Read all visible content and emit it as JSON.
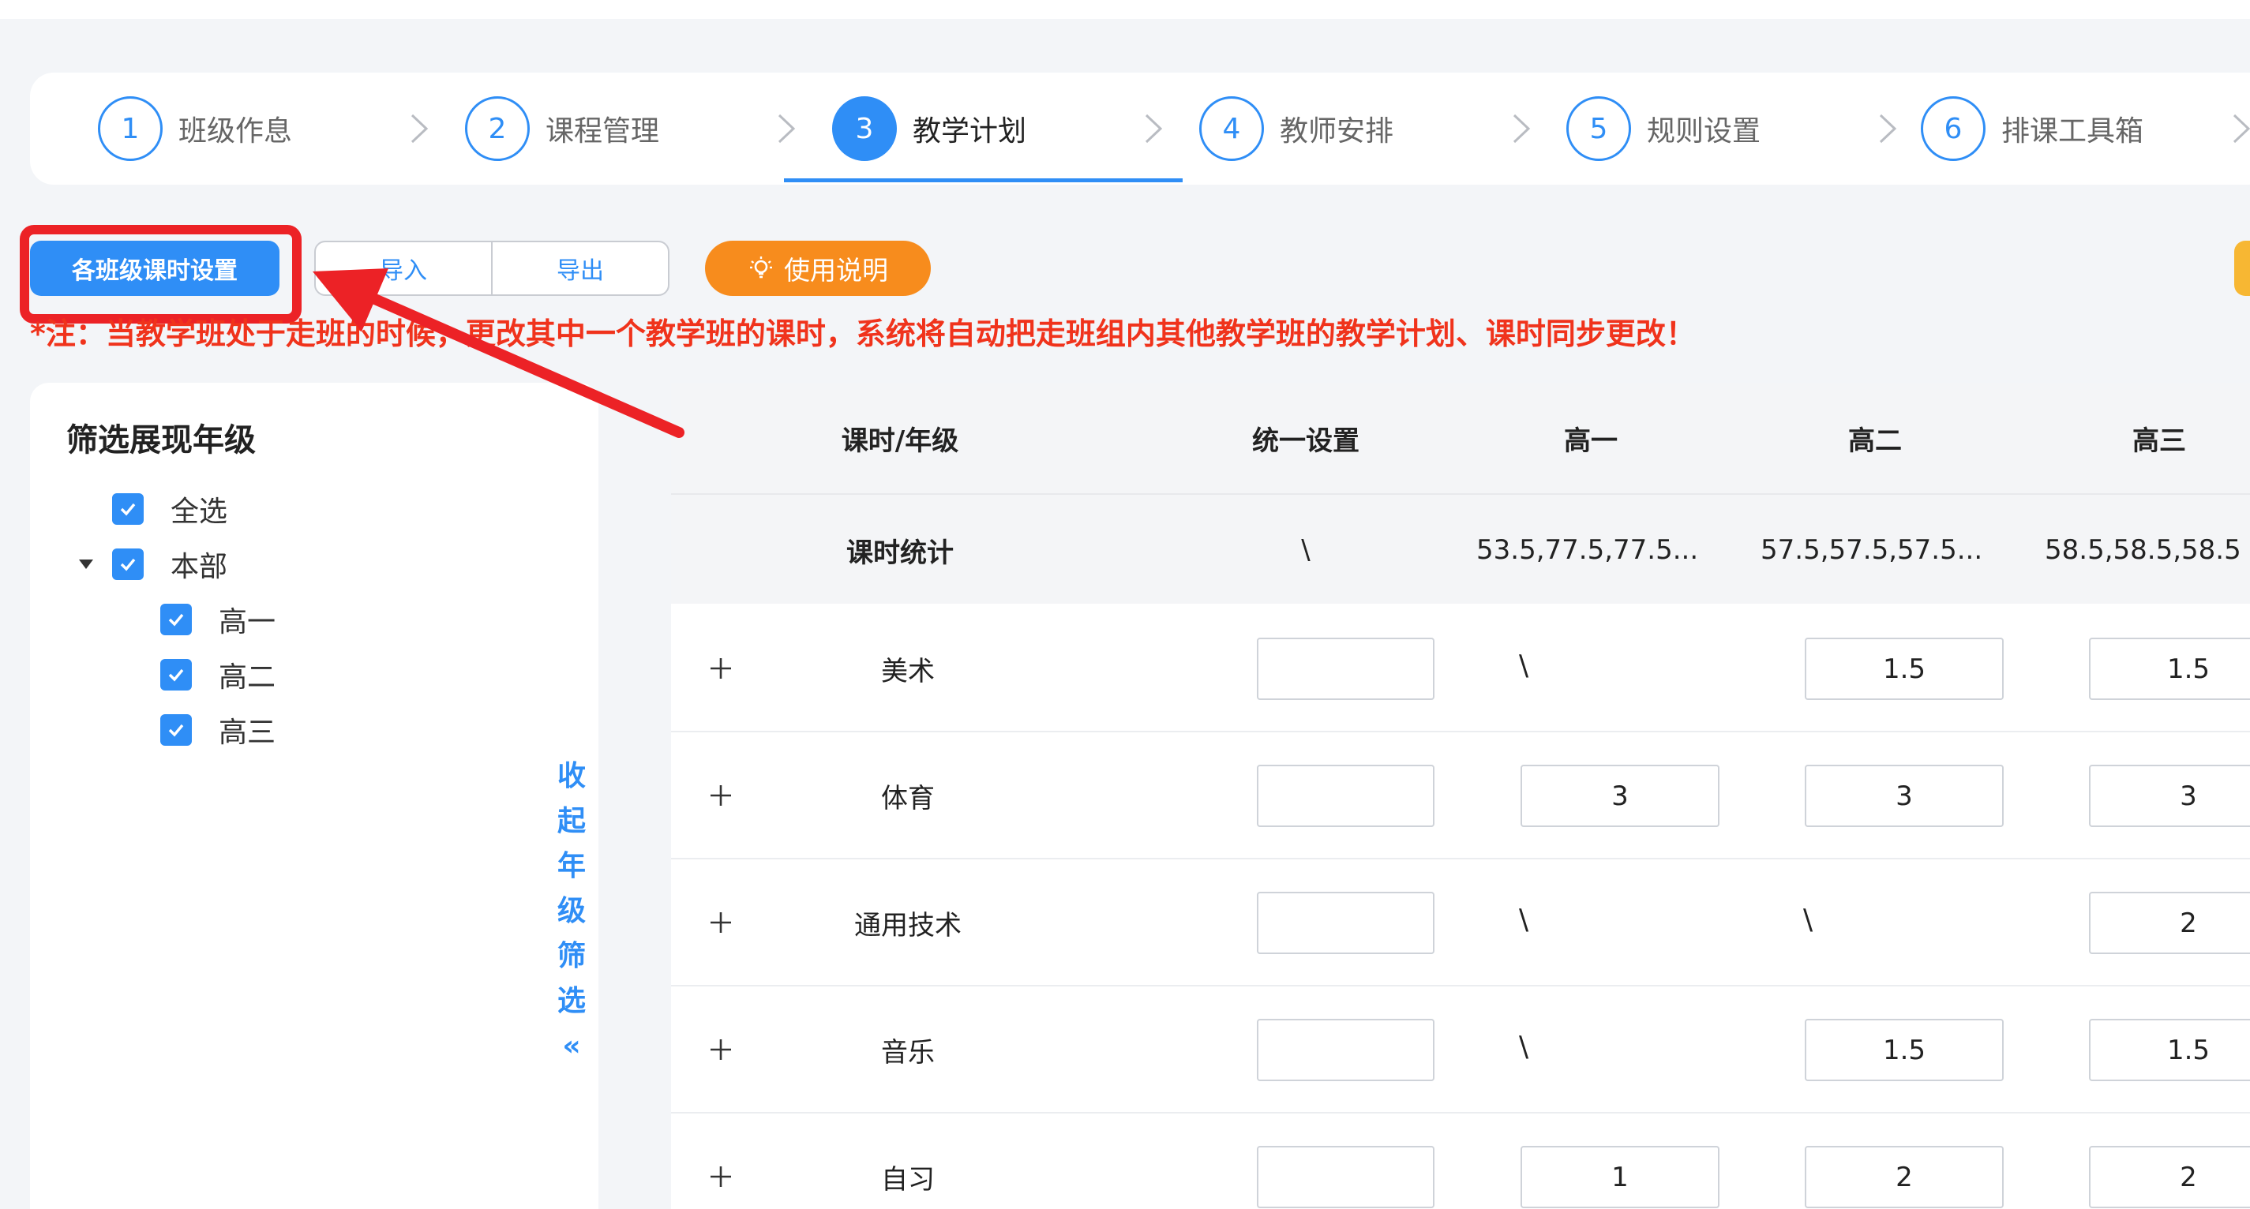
{
  "steps": [
    {
      "num": "1",
      "label": "班级作息",
      "active": false
    },
    {
      "num": "2",
      "label": "课程管理",
      "active": false
    },
    {
      "num": "3",
      "label": "教学计划",
      "active": true
    },
    {
      "num": "4",
      "label": "教师安排",
      "active": false
    },
    {
      "num": "5",
      "label": "规则设置",
      "active": false
    },
    {
      "num": "6",
      "label": "排课工具箱",
      "active": false
    }
  ],
  "toolbar": {
    "class_hours_button": "各班级课时设置",
    "import_label": "导入",
    "export_label": "导出",
    "help_label": "使用说明"
  },
  "notice": "*注：当教学班处于走班的时候，更改其中一个教学班的课时，系统将自动把走班组内其他教学班的教学计划、课时同步更改！",
  "filter": {
    "title": "筛选展现年级",
    "items": [
      {
        "label": "全选",
        "checked": true
      },
      {
        "label": "本部",
        "checked": true
      },
      {
        "label": "高一",
        "checked": true
      },
      {
        "label": "高二",
        "checked": true
      },
      {
        "label": "高三",
        "checked": true
      }
    ],
    "collapse_chars": [
      "收",
      "起",
      "年",
      "级",
      "筛",
      "选",
      "«"
    ]
  },
  "table": {
    "headers": [
      "课时/年级",
      "统一设置",
      "高一",
      "高二",
      "高三"
    ],
    "stats": {
      "label": "课时统计",
      "unified": "\\",
      "g1": "53.5,77.5,77.5...",
      "g2": "57.5,57.5,57.5...",
      "g3": "58.5,58.5,58.5"
    },
    "rows": [
      {
        "subject": "美术",
        "unified": "",
        "g1": "\\",
        "g2": "1.5",
        "g3": "1.5"
      },
      {
        "subject": "体育",
        "unified": "",
        "g1": "3",
        "g2": "3",
        "g3": "3"
      },
      {
        "subject": "通用技术",
        "unified": "",
        "g1": "\\",
        "g2": "\\",
        "g3": "2"
      },
      {
        "subject": "音乐",
        "unified": "",
        "g1": "\\",
        "g2": "1.5",
        "g3": "1.5"
      },
      {
        "subject": "自习",
        "unified": "",
        "g1": "1",
        "g2": "2",
        "g3": "2"
      }
    ]
  },
  "colors": {
    "primary": "#2f8ef6",
    "help_button": "#f78c1d",
    "notice_text": "#f0331c",
    "annotation_red": "#ec2226"
  }
}
